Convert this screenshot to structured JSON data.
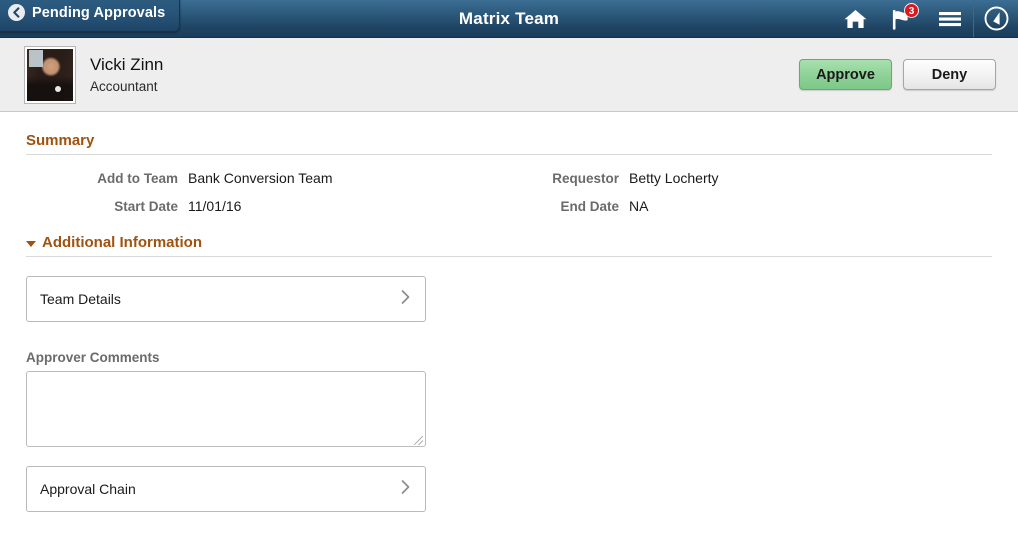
{
  "header": {
    "back_label": "Pending Approvals",
    "back_icon": "chevron-left-icon",
    "title": "Matrix Team",
    "icons": [
      {
        "name": "home-icon",
        "badge": null
      },
      {
        "name": "flag-icon",
        "badge": "3"
      },
      {
        "name": "hamburger-menu-icon",
        "badge": null
      },
      {
        "name": "navigator-compass-icon",
        "badge": null
      }
    ],
    "badge_color": "#d81921",
    "bar_color": "#2f5d80"
  },
  "person": {
    "name": "Vicki Zinn",
    "job_title": "Accountant",
    "avatar_alt": "employee-photo"
  },
  "actions": {
    "approve_label": "Approve",
    "approve_color": "#8ed197",
    "deny_label": "Deny",
    "deny_color": "#f2f2f2"
  },
  "summary": {
    "heading": "Summary",
    "heading_color": "#a0520f",
    "left_fields": [
      {
        "label": "Add to Team",
        "value": "Bank Conversion Team"
      },
      {
        "label": "Start Date",
        "value": "11/01/16"
      }
    ],
    "right_fields": [
      {
        "label": "Requestor",
        "value": "Betty Locherty"
      },
      {
        "label": "End Date",
        "value": "NA"
      }
    ]
  },
  "additional": {
    "heading": "Additional Information",
    "expanded": true,
    "team_details_label": "Team Details",
    "team_details_icon": "chevron-right-icon",
    "comments_label": "Approver Comments",
    "comments_value": "",
    "comments_placeholder": "",
    "approval_chain_label": "Approval Chain",
    "approval_chain_icon": "chevron-right-icon"
  }
}
